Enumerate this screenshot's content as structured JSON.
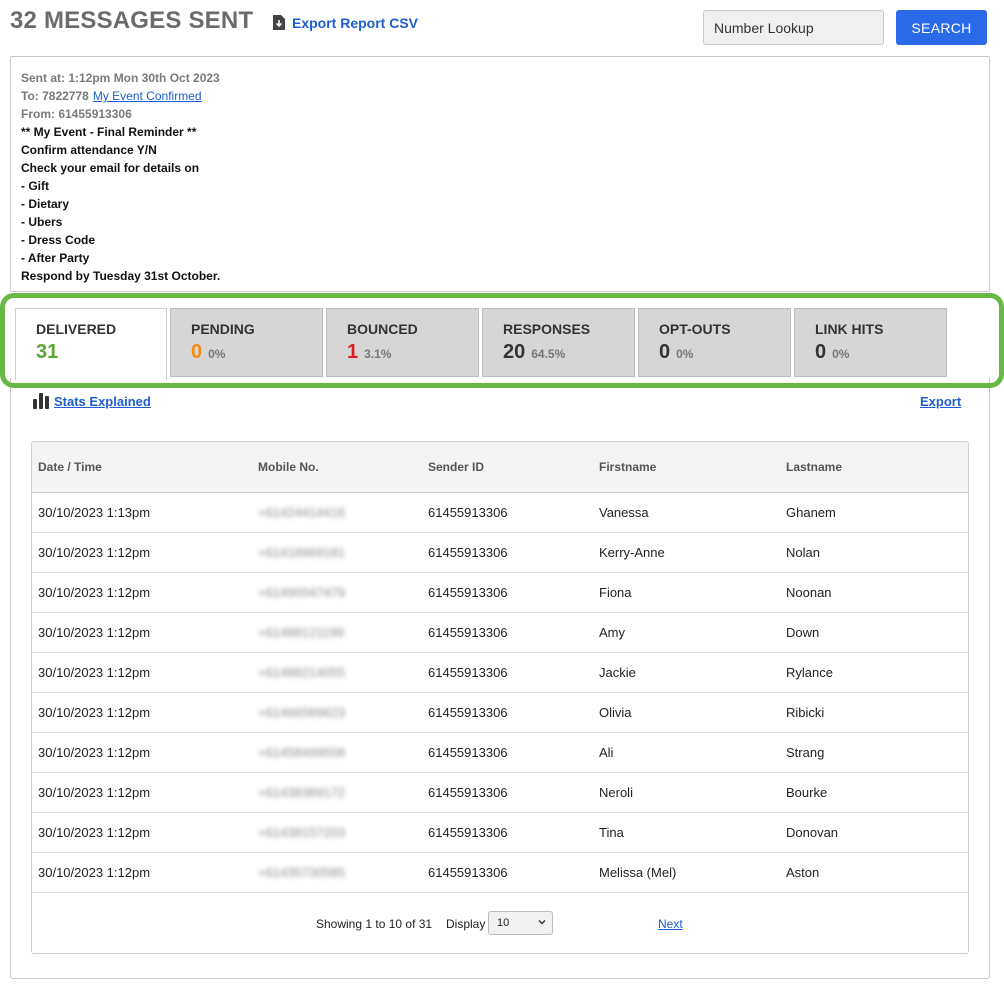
{
  "header": {
    "title": "32 MESSAGES SENT",
    "export_csv_label": "Export Report CSV",
    "lookup_placeholder": "Number Lookup",
    "search_label": "SEARCH"
  },
  "message": {
    "sent_at": "Sent at: 1:12pm Mon 30th Oct 2023",
    "to_label": "To: 7822778",
    "to_link": "My Event Confirmed",
    "from": "From: 61455913306",
    "lines": [
      "** My Event - Final Reminder **",
      "Confirm attendance Y/N",
      "Check your email for details on",
      "- Gift",
      "- Dietary",
      "- Ubers",
      "- Dress Code",
      "- After Party",
      "Respond by Tuesday 31st October."
    ]
  },
  "tabs": [
    {
      "label": "DELIVERED",
      "count": "31",
      "pct": "",
      "color": "#5aa832"
    },
    {
      "label": "PENDING",
      "count": "0",
      "pct": "0%",
      "color": "#f28c0f"
    },
    {
      "label": "BOUNCED",
      "count": "1",
      "pct": "3.1%",
      "color": "#d91f1f"
    },
    {
      "label": "RESPONSES",
      "count": "20",
      "pct": "64.5%",
      "color": "#333333"
    },
    {
      "label": "OPT-OUTS",
      "count": "0",
      "pct": "0%",
      "color": "#333333"
    },
    {
      "label": "LINK HITS",
      "count": "0",
      "pct": "0%",
      "color": "#333333"
    }
  ],
  "stats_explained_label": "Stats Explained",
  "export_label": "Export",
  "table": {
    "headers": [
      "Date / Time",
      "Mobile No.",
      "Sender ID",
      "Firstname",
      "Lastname"
    ],
    "rows": [
      [
        "30/10/2023 1:13pm",
        "+61424414416",
        "61455913306",
        "Vanessa",
        "Ghanem"
      ],
      [
        "30/10/2023 1:12pm",
        "+61418969181",
        "61455913306",
        "Kerry-Anne",
        "Nolan"
      ],
      [
        "30/10/2023 1:12pm",
        "+61490047479",
        "61455913306",
        "Fiona",
        "Noonan"
      ],
      [
        "30/10/2023 1:12pm",
        "+61488121199",
        "61455913306",
        "Amy",
        "Down"
      ],
      [
        "30/10/2023 1:12pm",
        "+61488214055",
        "61455913306",
        "Jackie",
        "Rylance"
      ],
      [
        "30/10/2023 1:12pm",
        "+61466589623",
        "61455913306",
        "Olivia",
        "Ribicki"
      ],
      [
        "30/10/2023 1:12pm",
        "+61458499508",
        "61455913306",
        "Ali",
        "Strang"
      ],
      [
        "30/10/2023 1:12pm",
        "+61438389172",
        "61455913306",
        "Neroli",
        "Bourke"
      ],
      [
        "30/10/2023 1:12pm",
        "+61438157203",
        "61455913306",
        "Tina",
        "Donovan"
      ],
      [
        "30/10/2023 1:12pm",
        "+61435730585",
        "61455913306",
        "Melissa (Mel)",
        "Aston"
      ]
    ]
  },
  "pager": {
    "showing": "Showing 1 to 10 of 31",
    "display_label": "Display",
    "display_value": "10",
    "next_label": "Next"
  }
}
